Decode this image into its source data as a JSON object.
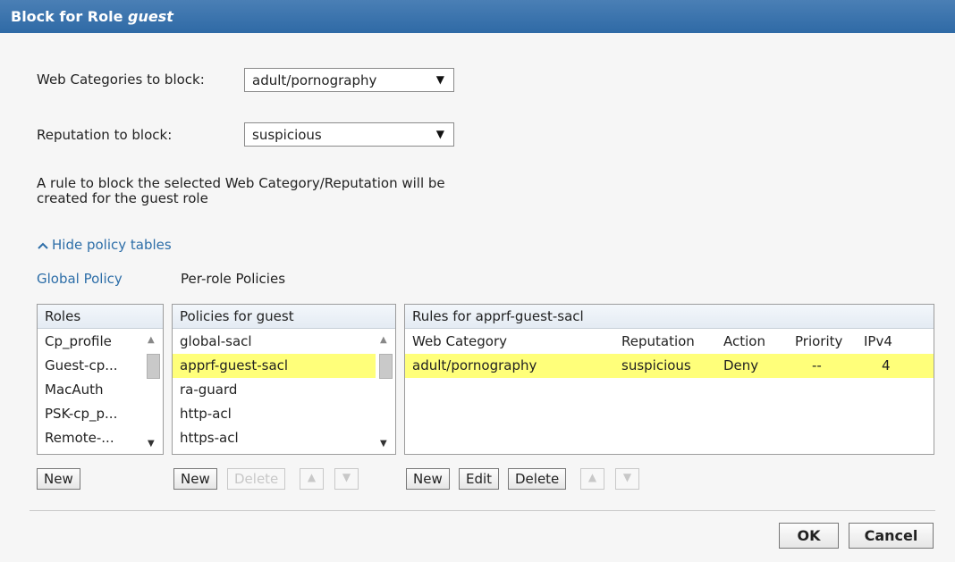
{
  "title": {
    "prefix": "Block for Role",
    "role": "guest"
  },
  "web_categories": {
    "label": "Web Categories to block:",
    "value": "adult/pornography"
  },
  "reputation": {
    "label": "Reputation to block:",
    "value": "suspicious"
  },
  "description": {
    "line1": "A rule to block the selected Web Category/Reputation will be",
    "line2": "created for the guest role"
  },
  "toggle_link": {
    "icon": "chevron-up-icon",
    "label": "Hide policy tables"
  },
  "tabs": {
    "global": "Global Policy",
    "per_role": "Per-role Policies"
  },
  "roles_panel": {
    "header": "Roles",
    "items": [
      "Cp_profile",
      "Guest-cp...",
      "MacAuth",
      "PSK-cp_p...",
      "Remote-..."
    ],
    "new_label": "New"
  },
  "policies_panel": {
    "header": "Policies for guest",
    "items": [
      "global-sacl",
      "apprf-guest-sacl",
      "ra-guard",
      "http-acl",
      "https-acl"
    ],
    "selected": "apprf-guest-sacl",
    "new_label": "New",
    "delete_label": "Delete"
  },
  "rules_panel": {
    "header": "Rules for apprf-guest-sacl",
    "columns": [
      "Web Category",
      "Reputation",
      "Action",
      "Priority",
      "IPv4"
    ],
    "rows": [
      {
        "web_category": "adult/pornography",
        "reputation": "suspicious",
        "action": "Deny",
        "priority": "--",
        "ipv4": "4"
      }
    ],
    "new_label": "New",
    "edit_label": "Edit",
    "delete_label": "Delete"
  },
  "footer": {
    "ok_label": "OK",
    "cancel_label": "Cancel"
  },
  "colors": {
    "title_bar": "#2f6aa6",
    "selection": "#ffff7a",
    "link": "#2d6ea8"
  }
}
